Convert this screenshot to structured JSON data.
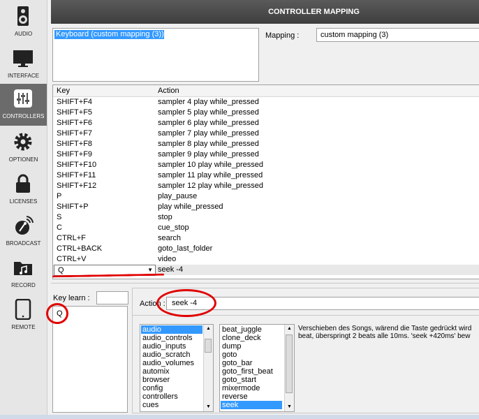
{
  "sidebar": {
    "items": [
      {
        "label": "AUDIO",
        "icon": "speaker-icon"
      },
      {
        "label": "INTERFACE",
        "icon": "monitor-icon"
      },
      {
        "label": "CONTROLLERS",
        "icon": "sliders-icon",
        "active": true
      },
      {
        "label": "OPTIONEN",
        "icon": "gear-icon"
      },
      {
        "label": "LICENSES",
        "icon": "lock-icon"
      },
      {
        "label": "BROADCAST",
        "icon": "broadcast-icon"
      },
      {
        "label": "RECORD",
        "icon": "folder-music-icon"
      },
      {
        "label": "REMOTE",
        "icon": "tablet-icon"
      }
    ]
  },
  "header": {
    "title": "CONTROLLER MAPPING"
  },
  "controllers": {
    "items": [
      "Keyboard (custom mapping (3))"
    ]
  },
  "mapping": {
    "label": "Mapping :",
    "value": "custom mapping (3)"
  },
  "table": {
    "headers": {
      "key": "Key",
      "action": "Action"
    },
    "rows": [
      {
        "key": "SHIFT+F4",
        "action": "sampler 4 play while_pressed"
      },
      {
        "key": "SHIFT+F5",
        "action": "sampler 5 play while_pressed"
      },
      {
        "key": "SHIFT+F6",
        "action": "sampler 6 play while_pressed"
      },
      {
        "key": "SHIFT+F7",
        "action": "sampler 7 play while_pressed"
      },
      {
        "key": "SHIFT+F8",
        "action": "sampler 8 play while_pressed"
      },
      {
        "key": "SHIFT+F9",
        "action": "sampler 9 play while_pressed"
      },
      {
        "key": "SHIFT+F10",
        "action": "sampler 10 play while_pressed"
      },
      {
        "key": "SHIFT+F11",
        "action": "sampler 11 play while_pressed"
      },
      {
        "key": "SHIFT+F12",
        "action": "sampler 12 play while_pressed"
      },
      {
        "key": "P",
        "action": "play_pause"
      },
      {
        "key": "SHIFT+P",
        "action": "play while_pressed"
      },
      {
        "key": "S",
        "action": "stop"
      },
      {
        "key": "C",
        "action": "cue_stop"
      },
      {
        "key": "CTRL+F",
        "action": "search"
      },
      {
        "key": "CTRL+BACK",
        "action": "goto_last_folder"
      },
      {
        "key": "CTRL+V",
        "action": "video"
      }
    ],
    "selected": {
      "key": "Q",
      "action": "seek -4"
    }
  },
  "key_learn": {
    "label": "Key learn :",
    "input_value": "",
    "captured": "Q"
  },
  "action": {
    "label": "Action :",
    "value": "seek -4"
  },
  "categories": {
    "items": [
      "audio",
      "audio_controls",
      "audio_inputs",
      "audio_scratch",
      "audio_volumes",
      "automix",
      "browser",
      "config",
      "controllers",
      "cues"
    ],
    "selected": "audio"
  },
  "verbs": {
    "items": [
      "beat_juggle",
      "clone_deck",
      "dump",
      "goto",
      "goto_bar",
      "goto_first_beat",
      "goto_start",
      "mixermode",
      "reverse",
      "seek"
    ],
    "selected": "seek"
  },
  "description": {
    "line1": "Verschieben des Songs, wärend die Taste gedrückt wird",
    "line2": "beat, überspringt 2 beats alle 10ms. 'seek +420ms' bew"
  },
  "colors": {
    "accent": "#3399ff",
    "annotation": "#e00000",
    "header": "#4a4a4a"
  }
}
